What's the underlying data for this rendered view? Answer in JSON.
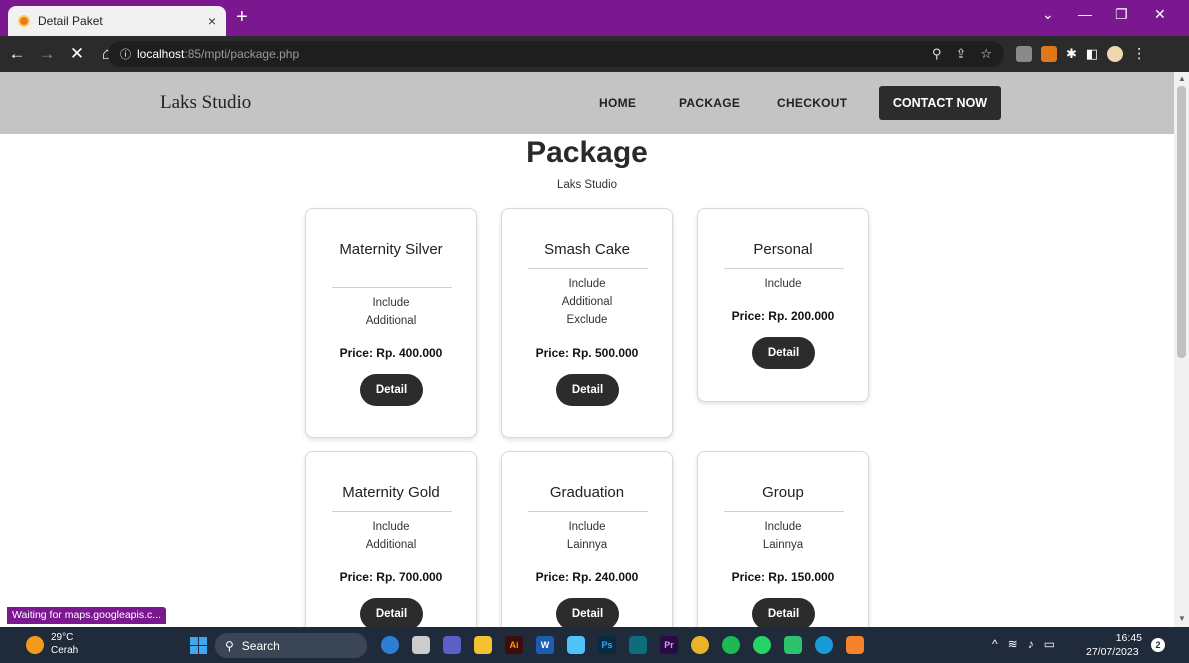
{
  "browser": {
    "tab_title": "Detail Paket",
    "tab_close": "×",
    "new_tab": "+",
    "url_host": "localhost",
    "url_path": ":85/mpti/package.php",
    "status_text": "Waiting for maps.googleapis.c..."
  },
  "site": {
    "logo": "Laks Studio",
    "nav": [
      {
        "label": "HOME"
      },
      {
        "label": "PACKAGE"
      },
      {
        "label": "CHECKOUT"
      }
    ],
    "contact_label": "CONTACT NOW",
    "page_title": "Package",
    "page_subtitle": "Laks Studio",
    "detail_label": "Detail",
    "packages": [
      {
        "name": "Maternity Silver",
        "lines": [
          "Include",
          "Additional"
        ],
        "price": "Price: Rp. 400.000"
      },
      {
        "name": "Smash Cake",
        "lines": [
          "Include",
          "Additional",
          "Exclude"
        ],
        "price": "Price: Rp. 500.000"
      },
      {
        "name": "Personal",
        "lines": [
          "Include"
        ],
        "price": "Price: Rp. 200.000"
      },
      {
        "name": "Maternity Gold",
        "lines": [
          "Include",
          "Additional"
        ],
        "price": "Price: Rp. 700.000"
      },
      {
        "name": "Graduation",
        "lines": [
          "Include",
          "Lainnya"
        ],
        "price": "Price: Rp. 240.000"
      },
      {
        "name": "Group",
        "lines": [
          "Include",
          "Lainnya"
        ],
        "price": "Price: Rp. 150.000"
      }
    ]
  },
  "taskbar": {
    "weather_temp": "29°C",
    "weather_cond": "Cerah",
    "search_label": "Search",
    "time": "16:45",
    "date": "27/07/2023",
    "notification_count": "2"
  },
  "colors": {
    "browser_frame": "#7b1890",
    "header_bg": "#c4c4c4",
    "button_dark": "#2c2c2c",
    "taskbar_bg": "#1f2a3a"
  }
}
